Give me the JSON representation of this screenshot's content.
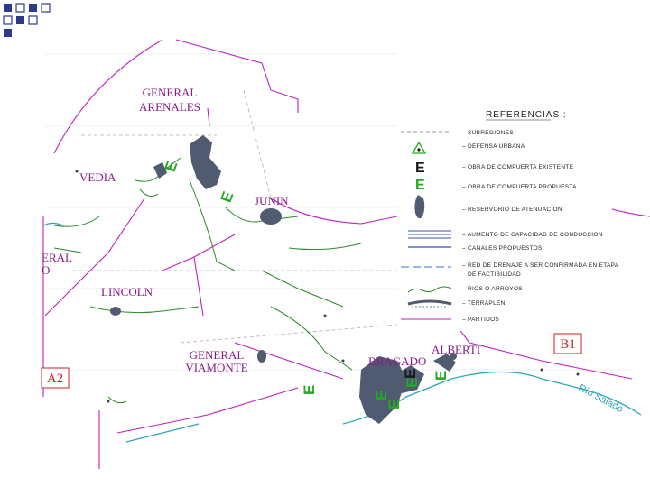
{
  "colors": {
    "boundary": "#c020c0",
    "river": "#2a8a2a",
    "reservoir": "#505a70",
    "obra_existente": "#1a1a1a",
    "obra_propuesta": "#22aa22",
    "region_box": "#cc2222",
    "deco_squares": "#2d3a8c"
  },
  "districts": {
    "general_arenales": "GENERAL ARENALES",
    "vedia": "VEDIA",
    "junin": "JUNIN",
    "general_viamonte_partial": "ERAL O",
    "lincoln": "LINCOLN",
    "general_viamonte": "GENERAL VIAMONTE",
    "bragado": "BRAGADO",
    "alberti": "ALBERTI"
  },
  "region_boxes": {
    "a2": "A2",
    "b1": "B1"
  },
  "river_label": "Río Salado",
  "legend": {
    "title": "REFERENCIAS :",
    "items": [
      {
        "icon": "subregion-line-icon",
        "label": "SUBREGIONES"
      },
      {
        "icon": "urban-defense-icon",
        "label": "DEFENSA URBANA"
      },
      {
        "icon": "existing-gate-icon",
        "symbol": "E",
        "label": "OBRA DE COMPUERTA EXISTENTE"
      },
      {
        "icon": "proposed-gate-icon",
        "symbol": "E",
        "label": "OBRA DE COMPUERTA PROPUESTA"
      },
      {
        "icon": "reservoir-icon",
        "label": "RESERVORIO DE ATENUACION"
      },
      {
        "icon": "capacity-lines-icon",
        "label": "AUMENTO DE CAPACIDAD DE CONDUCCION"
      },
      {
        "icon": "proposed-channel-icon",
        "label": "CANALES PROPUESTOS"
      },
      {
        "icon": "drainage-network-icon",
        "label": "RED DE DRENAJE A SER CONFIRMADA EN ETAPA",
        "label2": "DE FACTIBILIDAD"
      },
      {
        "icon": "rivers-icon",
        "label": "RIOS O ARROYOS"
      },
      {
        "icon": "embankment-icon",
        "label": "TERRAPLEN"
      },
      {
        "icon": "partidos-line-icon",
        "label": "PARTIDOS"
      }
    ]
  },
  "map_gate_symbol": "E"
}
